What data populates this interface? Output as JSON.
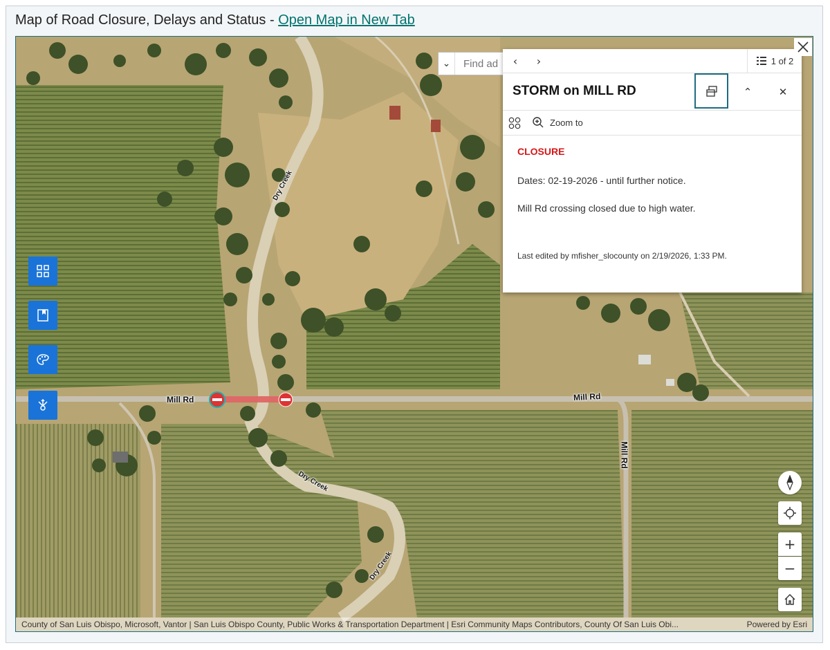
{
  "header": {
    "title": "Map of Road Closure, Delays and Status - ",
    "link_text": "Open Map in New Tab"
  },
  "search": {
    "placeholder": "Find ad"
  },
  "popup": {
    "page_count": "1 of 2",
    "title": "STORM on MILL RD",
    "zoom_label": "Zoom to",
    "status": "CLOSURE",
    "dates": "Dates: 02-19-2026 - until further notice.",
    "description": "Mill Rd crossing closed due to high water.",
    "last_edited": "Last edited by mfisher_slocounty on 2/19/2026, 1:33 PM."
  },
  "map_labels": {
    "road_west": "Mill Rd",
    "road_east": "Mill Rd",
    "road_vertical": "Mill Rd",
    "creek_north": "Dry Creek",
    "creek_mid": "Dry Creek",
    "creek_south": "Dry Creek"
  },
  "zoom": {
    "in": "+",
    "out": "−"
  },
  "attribution": {
    "text": "County of San Luis Obispo, Microsoft, Vantor | San Luis Obispo County, Public Works & Transportation Department | Esri Community Maps Contributors, County Of San Luis Obi...",
    "powered": "Powered by Esri"
  },
  "colors": {
    "accent_blue": "#1a73d8",
    "closure_red": "#d71616",
    "link_teal": "#00736f",
    "closed_segment": "#e05a5a"
  },
  "icons": [
    "basemap-gallery-icon",
    "bookmark-icon",
    "palette-icon",
    "network-icon",
    "compass-icon",
    "locate-icon",
    "home-icon",
    "dock-icon",
    "cluster-icon",
    "zoom-in-icon",
    "close-icon"
  ]
}
